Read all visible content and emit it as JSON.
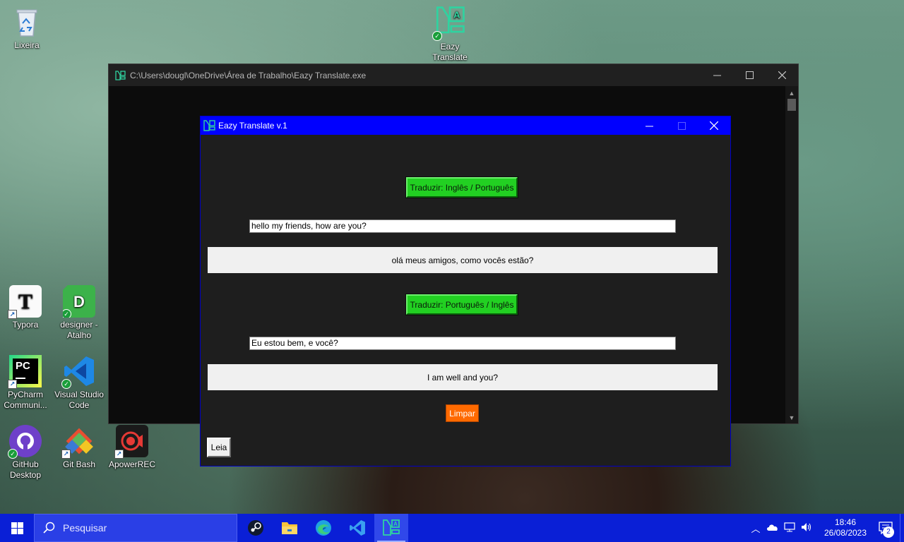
{
  "desktop": {
    "icons": [
      {
        "label": "Lixeira"
      },
      {
        "label": "Eazy Translate"
      },
      {
        "label": "Typora"
      },
      {
        "label": "designer - Atalho"
      },
      {
        "label": "PyCharm Communi..."
      },
      {
        "label": "Visual Studio Code"
      },
      {
        "label": "GitHub Desktop"
      },
      {
        "label": "Git Bash"
      },
      {
        "label": "ApowerREC"
      }
    ]
  },
  "console": {
    "title": "C:\\Users\\dougl\\OneDrive\\Área de Trabalho\\Eazy Translate.exe"
  },
  "app": {
    "title": "Eazy Translate v.1",
    "btn_en_pt": "Traduzir: Inglês / Português",
    "input_en": "hello my friends, how are you?",
    "output_pt": "olá meus amigos, como vocês estão?",
    "btn_pt_en": "Traduzir: Português / Inglês",
    "input_pt": "Eu estou bem, e você?",
    "output_en": "I am well and you?",
    "btn_clear": "Limpar",
    "btn_read": "Leia",
    "colors": {
      "titlebar": "#0000ff",
      "translate_button": "#22d022",
      "clear_button": "#ff6a00",
      "background": "#1e1e1e"
    }
  },
  "taskbar": {
    "search_placeholder": "Pesquisar",
    "apps": [
      "steam-icon",
      "file-explorer-icon",
      "edge-icon",
      "vscode-icon",
      "eazy-translate-icon"
    ],
    "time": "18:46",
    "date": "26/08/2023",
    "notification_count": "2"
  }
}
